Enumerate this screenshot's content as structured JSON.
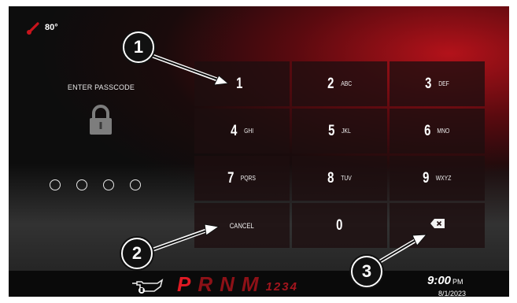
{
  "status": {
    "temperature": "80°"
  },
  "lock_panel": {
    "title": "ENTER PASSCODE",
    "pin_slots": 4
  },
  "keypad": {
    "keys": [
      {
        "num": "1",
        "sub": ""
      },
      {
        "num": "2",
        "sub": "ABC"
      },
      {
        "num": "3",
        "sub": "DEF"
      },
      {
        "num": "4",
        "sub": "GHI"
      },
      {
        "num": "5",
        "sub": "JKL"
      },
      {
        "num": "6",
        "sub": "MNO"
      },
      {
        "num": "7",
        "sub": "PQRS"
      },
      {
        "num": "8",
        "sub": "TUV"
      },
      {
        "num": "9",
        "sub": "WXYZ"
      }
    ],
    "cancel_label": "CANCEL",
    "zero": "0"
  },
  "bottom_bar": {
    "gears": [
      "P",
      "R",
      "N",
      "M"
    ],
    "gear_numbers": "1234",
    "time": "9:00",
    "ampm": "PM",
    "date": "8/1/2023"
  },
  "callouts": [
    "1",
    "2",
    "3"
  ],
  "colors": {
    "accent_red": "#c01620",
    "background": "#0d0d0d",
    "key_bg": "#1e0e0f"
  },
  "icons": [
    "thermometer-icon",
    "lock-icon",
    "backspace-icon",
    "oil-warning-icon"
  ]
}
